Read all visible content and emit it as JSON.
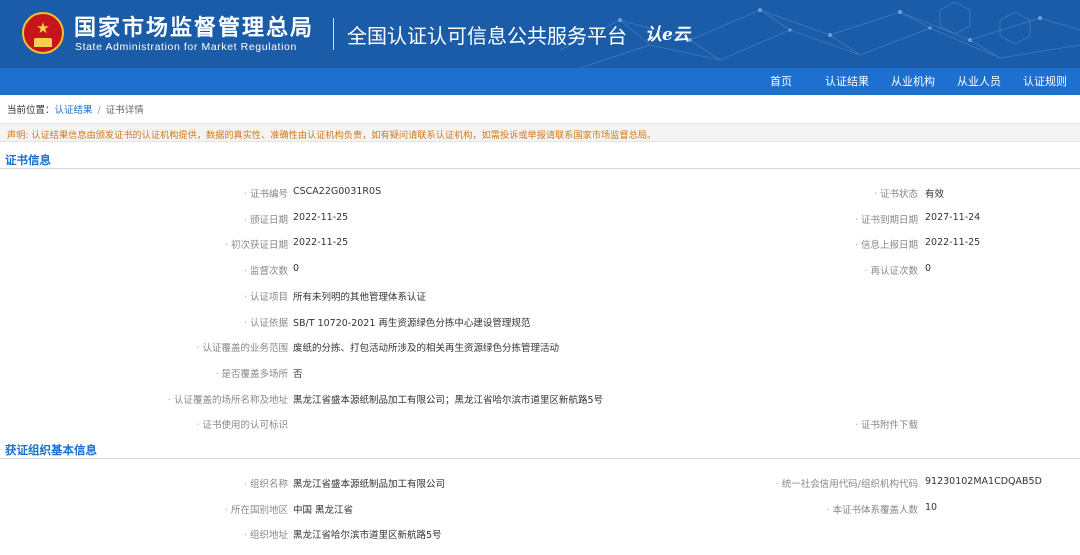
{
  "header": {
    "org_name_cn": "国家市场监督管理总局",
    "org_name_en": "State Administration  for  Market Regulation",
    "platform_name": "全国认证认可信息公共服务平台",
    "logo_text": "认e云",
    "colors": {
      "header_bg": "#1a5ca8",
      "nav_bg": "#1d6fd0",
      "emblem_red": "#c8151b",
      "emblem_gold": "#f2c230"
    }
  },
  "nav": {
    "items": [
      "首页",
      "认证结果",
      "从业机构",
      "从业人员",
      "认证规则"
    ]
  },
  "breadcrumb": {
    "prefix": "当前位置：",
    "link": "认证结果",
    "separator": "/",
    "current": "证书详情"
  },
  "notice": "声明: 认证结果信息由颁发证书的认证机构提供，数据的真实性、准确性由认证机构负责，如有疑问请联系认证机构，如需投诉或举报请联系国家市场监督总局。",
  "cert_section": {
    "title": "证书信息",
    "rows": [
      {
        "label": "证书编号",
        "value": "CSCA22G0031R0S",
        "right_label": "证书状态",
        "right_value": "有效"
      },
      {
        "label": "颁证日期",
        "value": "2022-11-25",
        "right_label": "证书到期日期",
        "right_value": "2027-11-24"
      },
      {
        "label": "初次获证日期",
        "value": "2022-11-25",
        "right_label": "信息上报日期",
        "right_value": "2022-11-25"
      },
      {
        "label": "监督次数",
        "value": "0",
        "right_label": "再认证次数",
        "right_value": "0"
      },
      {
        "label": "认证项目",
        "value": "所有未列明的其他管理体系认证"
      },
      {
        "label": "认证依据",
        "value": "SB/T 10720-2021 再生资源绿色分拣中心建设管理规范"
      },
      {
        "label": "认证覆盖的业务范围",
        "value": "废纸的分拣、打包活动所涉及的相关再生资源绿色分拣管理活动"
      },
      {
        "label": "是否覆盖多场所",
        "value": "否"
      },
      {
        "label": "认证覆盖的场所名称及地址",
        "value": "黑龙江省盛本源纸制品加工有限公司；黑龙江省哈尔滨市道里区新航路5号"
      },
      {
        "label": "证书使用的认可标识",
        "value": "",
        "right_label": "证书附件下载",
        "right_value": ""
      }
    ]
  },
  "org_section": {
    "title": "获证组织基本信息",
    "rows": [
      {
        "label": "组织名称",
        "value": "黑龙江省盛本源纸制品加工有限公司",
        "right_label": "统一社会信用代码/组织机构代码",
        "right_value": "91230102MA1CDQAB5D"
      },
      {
        "label": "所在国别地区",
        "value": "中国 黑龙江省",
        "right_label": "本证书体系覆盖人数",
        "right_value": "10"
      },
      {
        "label": "组织地址",
        "value": "黑龙江省哈尔滨市道里区新航路5号"
      }
    ]
  }
}
